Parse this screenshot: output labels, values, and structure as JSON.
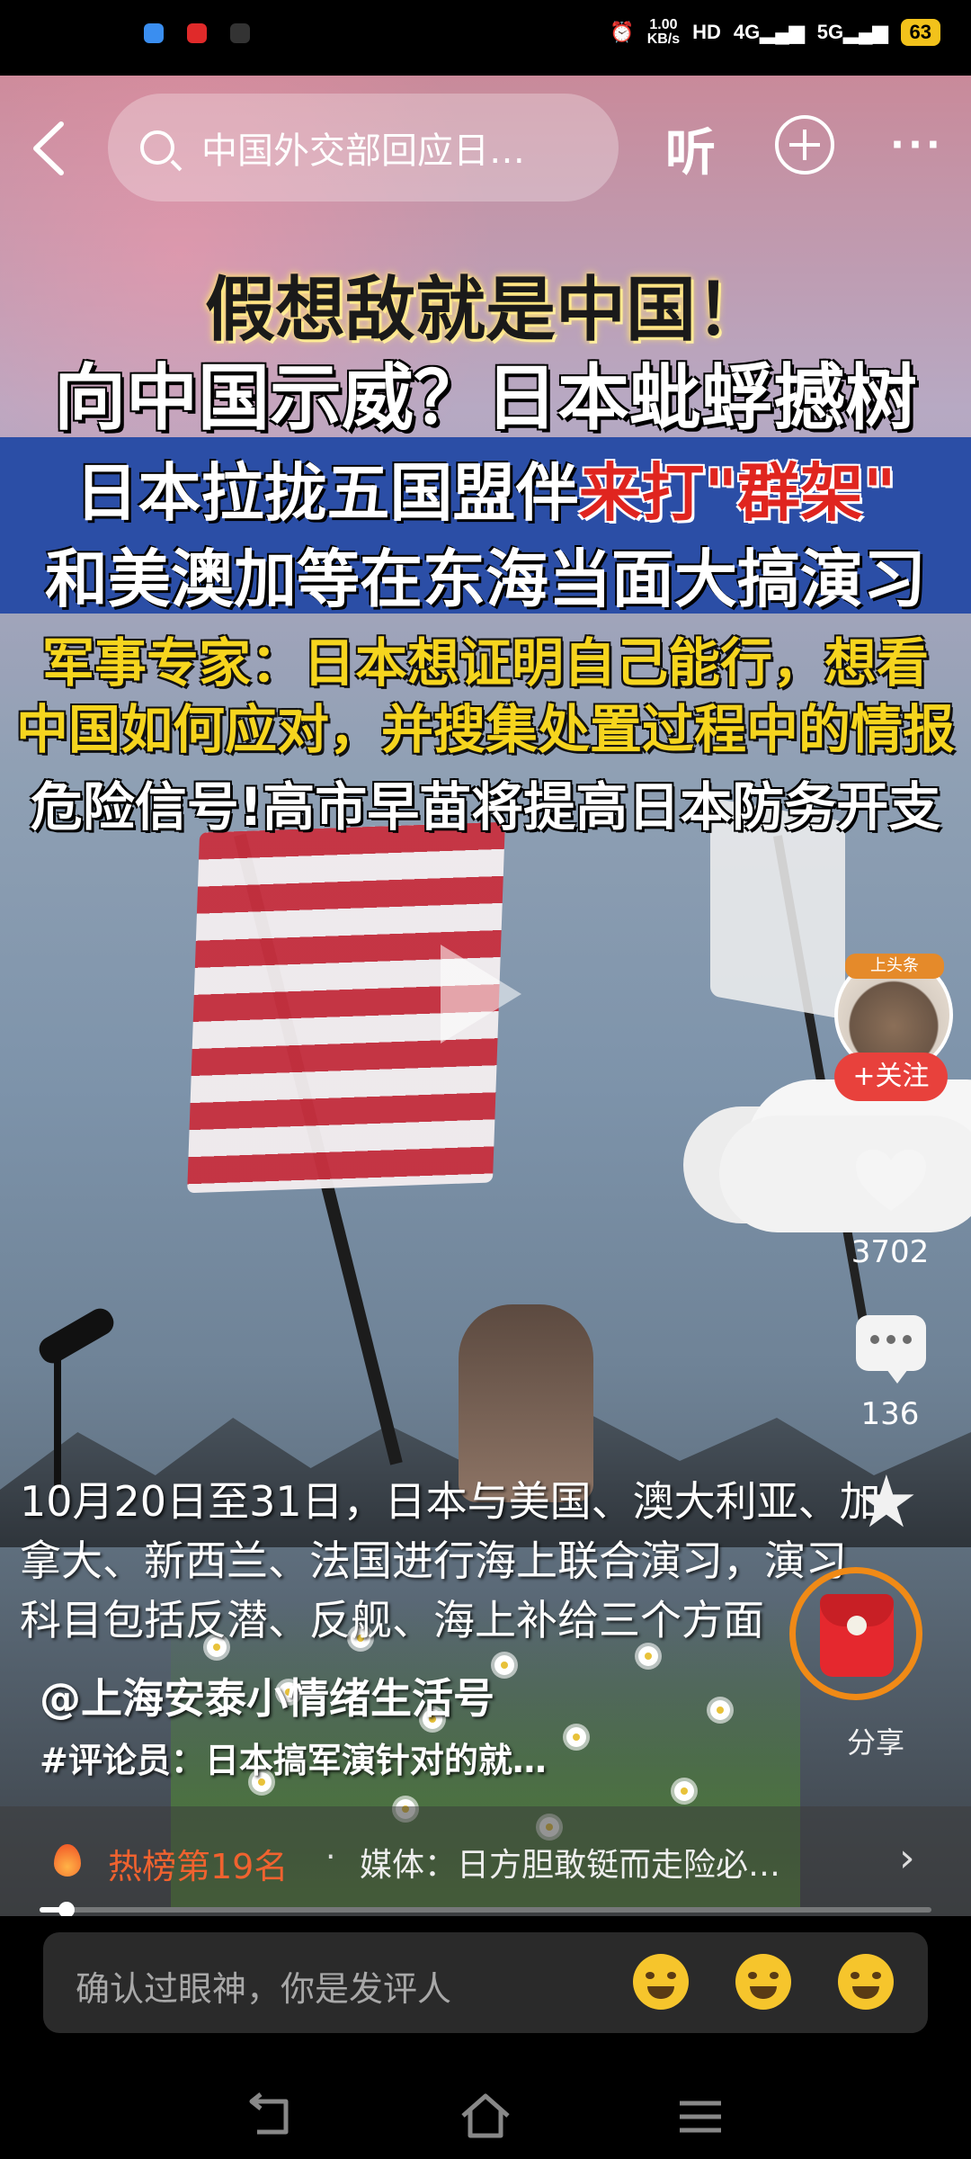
{
  "status_bar": {
    "network_speed_value": "1.00",
    "network_speed_unit": "KB/s",
    "hd_label": "HD",
    "sim1_label": "4G",
    "sim2_label": "5G",
    "battery": "63"
  },
  "top_bar": {
    "search_text": "中国外交部回应日…",
    "listen_label": "听"
  },
  "video_captions": {
    "line1": "假想敌就是中国！",
    "line2": "向中国示威？日本蚍蜉撼树",
    "line3_normal": "日本拉拢五国盟伴",
    "line3_red": "来打\"群架\"",
    "line4": "和美澳加等在东海当面大搞演习",
    "line5": "军事专家：日本想证明自己能行，想看",
    "line6": "中国如何应对，并搜集处置过程中的情报",
    "line7": "危险信号!高市早苗将提高日本防务开支"
  },
  "subtitle": {
    "line1": "10月20日至31日，日本与美国、澳大利亚、加",
    "line2": "拿大、新西兰、法国进行海上联合演习，演习",
    "line3": "科目包括反潜、反舰、海上补给三个方面"
  },
  "right_rail": {
    "avatar_badge": "上头条",
    "follow_label": "+关注",
    "like_count": "3702",
    "comment_count": "136",
    "share_label": "分享"
  },
  "author": {
    "name": "@上海安泰小情绪生活号",
    "hashtag": "#评论员：日本搞军演针对的就…"
  },
  "hot_bar": {
    "label": "热榜第19名",
    "separator": "·",
    "text": "媒体：日方胆敢铤而走险必…"
  },
  "progress": {
    "fraction": 0.03
  },
  "comment_bar": {
    "placeholder": "确认过眼神，你是发评人"
  }
}
